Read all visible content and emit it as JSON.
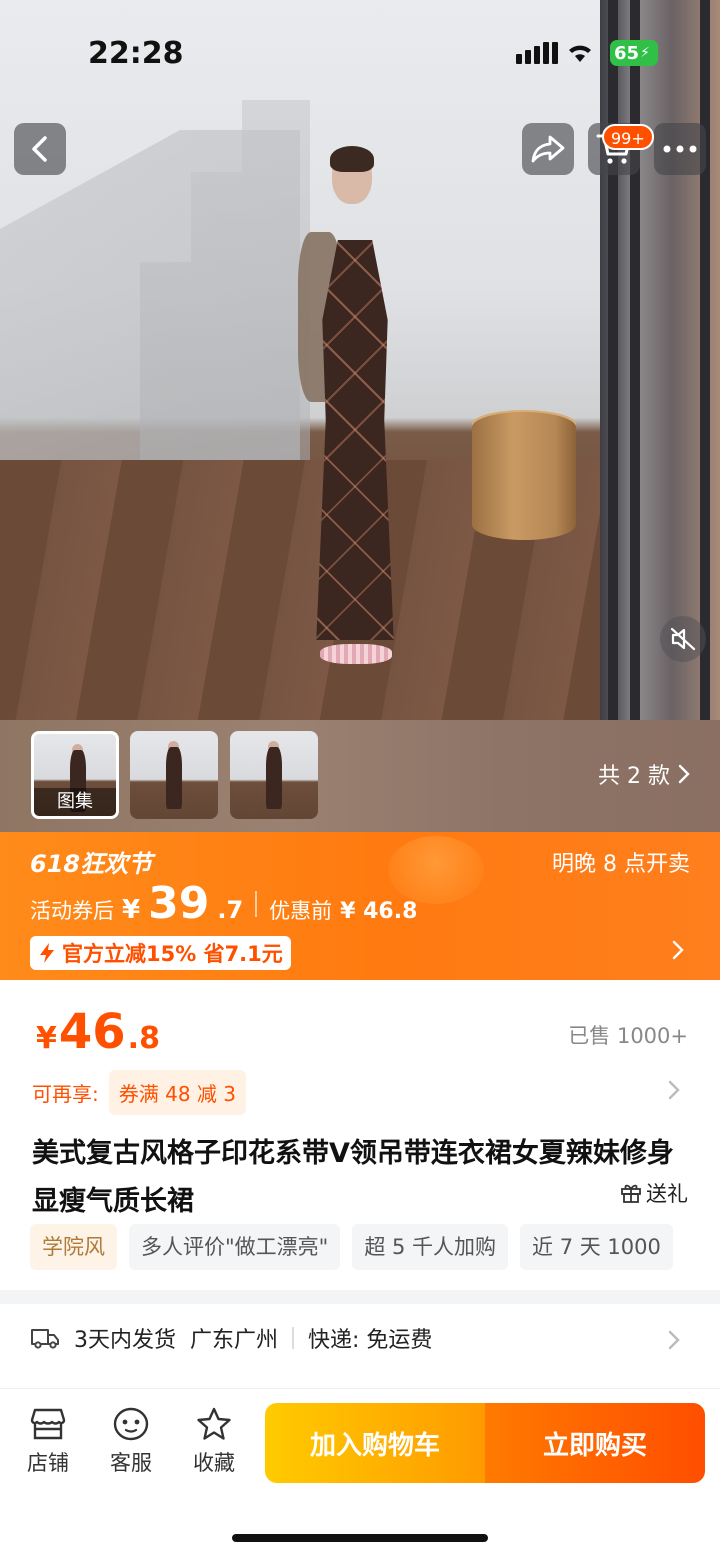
{
  "status_bar": {
    "time": "22:28",
    "battery": "65"
  },
  "header": {
    "cart_badge": "99+"
  },
  "gallery": {
    "thumbnail_label": "图集",
    "variants_text": "共 2 款"
  },
  "promo": {
    "title": "618狂欢节",
    "time_notice": "明晚 8 点开卖",
    "after_coupon_label": "活动券后",
    "currency": "¥",
    "after_coupon_int": "39",
    "after_coupon_dec": ".7",
    "before_label": "优惠前",
    "before_price": "¥ 46.8",
    "discount_tag": "官方立减15% 省7.1元"
  },
  "product": {
    "currency": "¥",
    "price_int": "46",
    "price_dec": ".8",
    "sold": "已售 1000+",
    "coupon_label": "可再享:",
    "coupon_chip": "券满 48 减 3",
    "title": "美式复古风格子印花系带V领吊带连衣裙女夏辣妹修身显瘦气质长裙",
    "gift": "送礼",
    "tags": [
      "学院风",
      "多人评价\"做工漂亮\"",
      "超 5 千人加购",
      "近 7 天 1000"
    ]
  },
  "shipping": {
    "delivery": "3天内发货",
    "location": "广东广州",
    "express": "快递: 免运费"
  },
  "bottom_bar": {
    "shop": "店铺",
    "service": "客服",
    "favorite": "收藏",
    "add_to_cart": "加入购物车",
    "buy_now": "立即购买"
  },
  "colors": {
    "accent": "#ff5000",
    "promo_bg": "#ff7a10",
    "cart_btn": "#ffb300",
    "buy_btn": "#ff5a00"
  }
}
